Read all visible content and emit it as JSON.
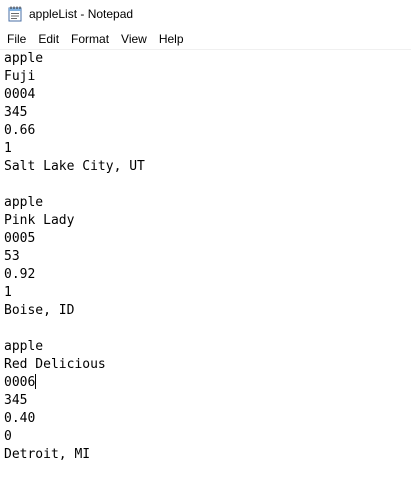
{
  "window": {
    "title": "appleList - Notepad",
    "app_icon": "notepad-icon"
  },
  "menu": {
    "file": "File",
    "edit": "Edit",
    "format": "Format",
    "view": "View",
    "help": "Help"
  },
  "document": {
    "lines": [
      "apple",
      "Fuji",
      "0004",
      "345",
      "0.66",
      "1",
      "Salt Lake City, UT",
      "",
      "apple",
      "Pink Lady",
      "0005",
      "53",
      "0.92",
      "1",
      "Boise, ID",
      "",
      "apple",
      "Red Delicious",
      "0006",
      "345",
      "0.40",
      "0",
      "Detroit, MI"
    ],
    "caret_after": "0006"
  }
}
